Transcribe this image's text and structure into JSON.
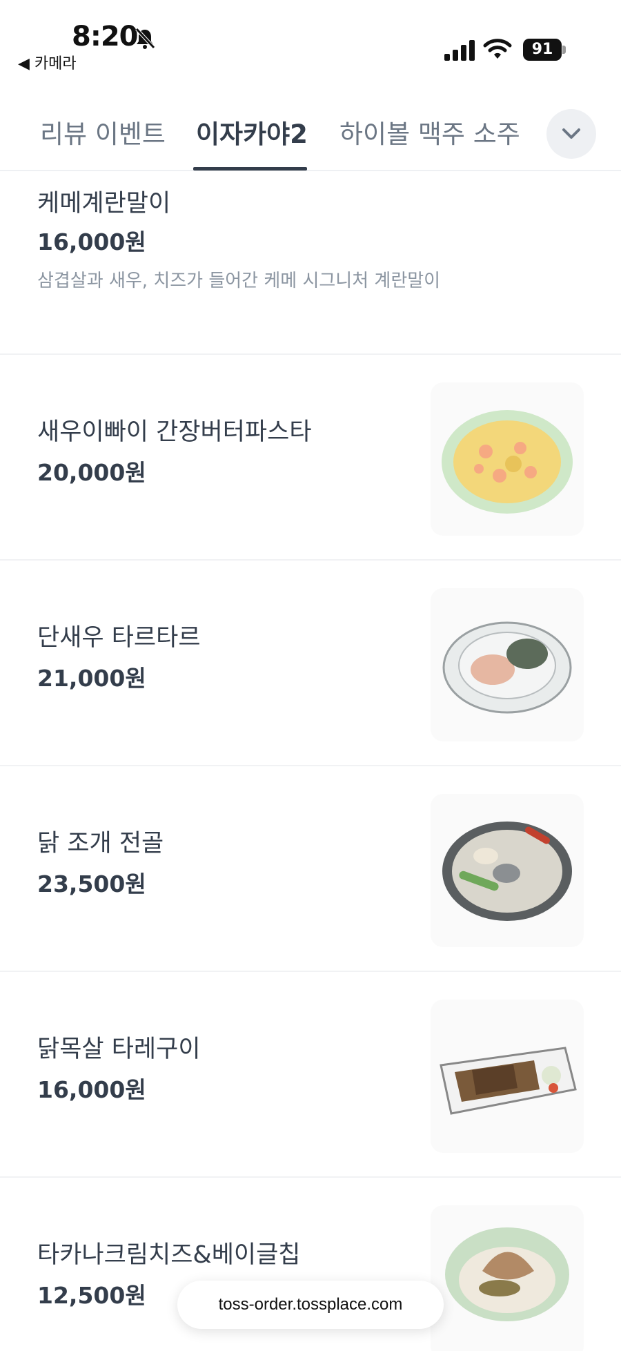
{
  "status_bar": {
    "time": "8:20",
    "back_app": "◀ 카메라",
    "battery": "91",
    "icons": [
      "bell-muted-icon",
      "signal-icon",
      "wifi-icon",
      "battery-icon"
    ]
  },
  "tabs": [
    {
      "label": "리뷰 이벤트",
      "active": false
    },
    {
      "label": "이자카야2",
      "active": true
    },
    {
      "label": "하이볼 맥주 소주",
      "active": false
    }
  ],
  "tab_more_icon": "chevron-down-icon",
  "menu_items": [
    {
      "name": "케메계란말이",
      "price": "16,000원",
      "description": "삼겹살과 새우, 치즈가 들어간 케메 시그니처 계란말이",
      "photo": null
    },
    {
      "name": "새우이빠이 간장버터파스타",
      "price": "20,000원",
      "photo": "shrimp-pasta-photo"
    },
    {
      "name": "단새우 타르타르",
      "price": "21,000원",
      "photo": "shrimp-tartare-photo"
    },
    {
      "name": "닭 조개 전골",
      "price": "23,500원",
      "photo": "chicken-clam-hotpot-photo"
    },
    {
      "name": "닭목살 타레구이",
      "price": "16,000원",
      "photo": "chicken-neck-tare-photo"
    },
    {
      "name": "타카나크림치즈&베이글칩",
      "price": "12,500원",
      "photo": "takana-cream-cheese-photo"
    }
  ],
  "url_pill": "toss-order.tossplace.com",
  "colors": {
    "text": "#333d4b",
    "muted": "#6b7684",
    "description": "#8b95a1",
    "divider": "#f1f2f4"
  }
}
